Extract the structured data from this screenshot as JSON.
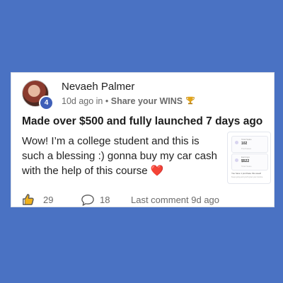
{
  "post": {
    "author": "Nevaeh Palmer",
    "level": "4",
    "time_prefix": "10d ago in •",
    "category": "Share your WINS",
    "title": "Made over $500 and fully launched 7 days ago",
    "body": "Wow! I’m a college student and this is such a blessing :) gonna buy my car cash with the help of this course",
    "heart": "❤️"
  },
  "attachment": {
    "card1_label": "Total Sales",
    "card1_value": "102",
    "card1_sub": "Purchases",
    "card2_label": "Earnings",
    "card2_value": "$522",
    "card2_sub": "Total Sales",
    "footer": "You have 1 purchase this week!",
    "footer_sub": "Keep going and you’ll grow your income"
  },
  "actions": {
    "likes": "29",
    "comments": "18",
    "last_comment": "Last comment 9d ago"
  },
  "colors": {
    "background": "#4a72c3",
    "badge": "#3f5fb8",
    "heart": "#e0262e"
  },
  "icons": [
    "trophy-icon",
    "like-icon",
    "comment-icon"
  ]
}
